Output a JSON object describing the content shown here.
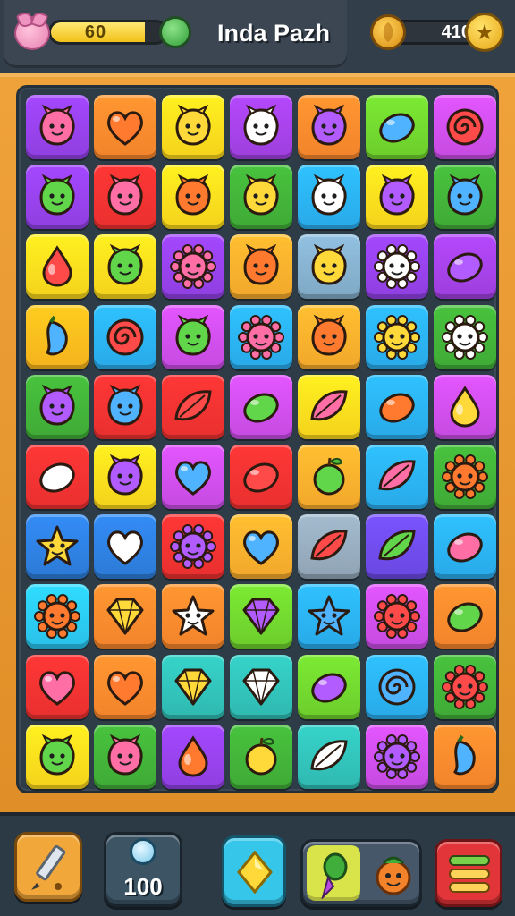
{
  "header": {
    "level_value": "60",
    "level_progress": 0.82,
    "title": "Inda Pazh",
    "coins": "410",
    "icons": {
      "level": "pink-creature-icon",
      "gem": "green-gem-icon",
      "coin": "gold-coin-icon",
      "star": "star-icon"
    }
  },
  "board": {
    "rows": 10,
    "cols": 7,
    "grid": [
      [
        {
          "c": "#8f3fe0",
          "i": "blob"
        },
        {
          "c": "#f2832b",
          "i": "heart"
        },
        {
          "c": "#f4d21c",
          "i": "blob"
        },
        {
          "c": "#9d3fdc",
          "i": "blob"
        },
        {
          "c": "#f2832b",
          "i": "blob"
        },
        {
          "c": "#6ccc2c",
          "i": "lemon"
        },
        {
          "c": "#c54be0",
          "i": "swirl"
        }
      ],
      [
        {
          "c": "#8f3fe0",
          "i": "blob"
        },
        {
          "c": "#e8302f",
          "i": "blob"
        },
        {
          "c": "#f4d21c",
          "i": "blob"
        },
        {
          "c": "#3faa36",
          "i": "blob"
        },
        {
          "c": "#29a9e8",
          "i": "blob"
        },
        {
          "c": "#f4d21c",
          "i": "blob"
        },
        {
          "c": "#3faa36",
          "i": "blob"
        }
      ],
      [
        {
          "c": "#f4d21c",
          "i": "drop"
        },
        {
          "c": "#f4d21c",
          "i": "blob"
        },
        {
          "c": "#8f3fe0",
          "i": "sun"
        },
        {
          "c": "#f2a72b",
          "i": "blob"
        },
        {
          "c": "#7fa8c4",
          "i": "blob"
        },
        {
          "c": "#8f3fe0",
          "i": "sun"
        },
        {
          "c": "#9d3fdc",
          "i": "lemon"
        }
      ],
      [
        {
          "c": "#f4b21c",
          "i": "pepper"
        },
        {
          "c": "#29a9e8",
          "i": "swirl"
        },
        {
          "c": "#c54be0",
          "i": "blob"
        },
        {
          "c": "#29a9e8",
          "i": "sun"
        },
        {
          "c": "#f2a72b",
          "i": "blob"
        },
        {
          "c": "#29a9e8",
          "i": "sun"
        },
        {
          "c": "#3faa36",
          "i": "sun"
        }
      ],
      [
        {
          "c": "#3faa36",
          "i": "blob"
        },
        {
          "c": "#e8302f",
          "i": "blob"
        },
        {
          "c": "#e8302f",
          "i": "leaf"
        },
        {
          "c": "#c54be0",
          "i": "lemon"
        },
        {
          "c": "#f4d21c",
          "i": "leaf"
        },
        {
          "c": "#29a9e8",
          "i": "lemon"
        },
        {
          "c": "#c54be0",
          "i": "drop"
        }
      ],
      [
        {
          "c": "#e8302f",
          "i": "lemon"
        },
        {
          "c": "#f4d21c",
          "i": "blob"
        },
        {
          "c": "#c54be0",
          "i": "heart"
        },
        {
          "c": "#e8302f",
          "i": "lemon"
        },
        {
          "c": "#f2a72b",
          "i": "apple"
        },
        {
          "c": "#29a9e8",
          "i": "leaf"
        },
        {
          "c": "#3faa36",
          "i": "sun"
        }
      ],
      [
        {
          "c": "#2c7ad6",
          "i": "star"
        },
        {
          "c": "#2c7ad6",
          "i": "heart"
        },
        {
          "c": "#e8302f",
          "i": "sun"
        },
        {
          "c": "#f2a72b",
          "i": "heart"
        },
        {
          "c": "#8fa3b4",
          "i": "leaf"
        },
        {
          "c": "#6a48e0",
          "i": "leaf"
        },
        {
          "c": "#29a9e8",
          "i": "lemon"
        }
      ],
      [
        {
          "c": "#29c0e8",
          "i": "sun"
        },
        {
          "c": "#f2832b",
          "i": "gem"
        },
        {
          "c": "#f2832b",
          "i": "star"
        },
        {
          "c": "#6ccc2c",
          "i": "gem"
        },
        {
          "c": "#29a9e8",
          "i": "star"
        },
        {
          "c": "#c54be0",
          "i": "sun"
        },
        {
          "c": "#f2832b",
          "i": "lemon"
        }
      ],
      [
        {
          "c": "#e8302f",
          "i": "heart"
        },
        {
          "c": "#f2832b",
          "i": "heart"
        },
        {
          "c": "#2fb8b0",
          "i": "gem"
        },
        {
          "c": "#2fb8b0",
          "i": "gem"
        },
        {
          "c": "#6ccc2c",
          "i": "lemon"
        },
        {
          "c": "#29a9e8",
          "i": "swirl"
        },
        {
          "c": "#3faa36",
          "i": "sun"
        }
      ],
      [
        {
          "c": "#f4d21c",
          "i": "blob"
        },
        {
          "c": "#3faa36",
          "i": "blob"
        },
        {
          "c": "#8f3fe0",
          "i": "drop"
        },
        {
          "c": "#3faa36",
          "i": "apple"
        },
        {
          "c": "#2fb8b0",
          "i": "leaf"
        },
        {
          "c": "#c54be0",
          "i": "sun"
        },
        {
          "c": "#f2832b",
          "i": "pepper"
        }
      ]
    ]
  },
  "footer": {
    "counter_value": "100",
    "buttons": {
      "pencil": "pencil-icon",
      "counter": "orb-icon",
      "diamond": "yellow-diamond-icon",
      "booster": "rocket-booster-icon",
      "menu": "menu-icon"
    }
  }
}
